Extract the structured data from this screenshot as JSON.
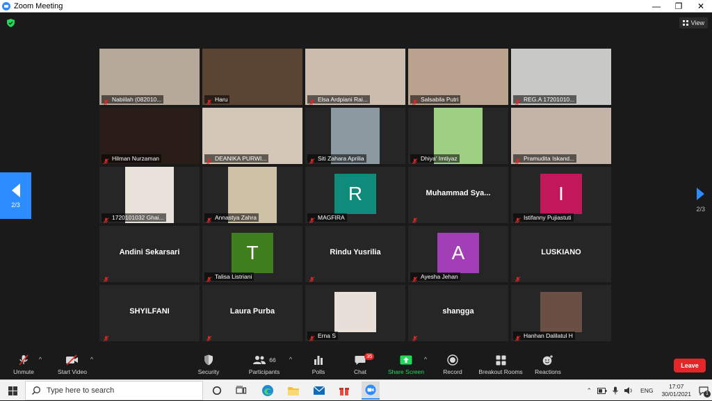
{
  "window": {
    "title": "Zoom Meeting",
    "minimize": "—",
    "maximize": "❐",
    "close": "✕"
  },
  "view_button": {
    "label": "View"
  },
  "pager": {
    "left_label": "2/3",
    "right_label": "2/3"
  },
  "participants": [
    {
      "name": "Nabiilah (082010...",
      "type": "video",
      "bg": "#b7a99a"
    },
    {
      "name": "Haru",
      "type": "video",
      "bg": "#5a4434"
    },
    {
      "name": "Elsa Ardpiani Rai...",
      "type": "video",
      "bg": "#cbbcae"
    },
    {
      "name": "Salsabila Putri",
      "type": "video",
      "bg": "#b9a38e"
    },
    {
      "name": "REG.A 17201010...",
      "type": "video",
      "bg": "#c8c9c4"
    },
    {
      "name": "Hilman Nurzaman",
      "type": "video",
      "bg": "#2a1d18"
    },
    {
      "name": "DEANIKA PURWI...",
      "type": "video",
      "bg": "#d4c7b8"
    },
    {
      "name": "Siti Zahara Aprilia",
      "type": "video-small",
      "bg": "#8a9aa0"
    },
    {
      "name": "Dhiya' Imtiyaz",
      "type": "video-small",
      "bg": "#9fcf83"
    },
    {
      "name": "Pramudita Iskand...",
      "type": "video",
      "bg": "#c3b4a7"
    },
    {
      "name": "1720101032 Ghai...",
      "type": "video-small",
      "bg": "#e8e2da"
    },
    {
      "name": "Annastya Zahra",
      "type": "video-small",
      "bg": "#cfc1a6"
    },
    {
      "name": "MAGFIRA",
      "type": "letter",
      "letter": "R",
      "color": "#0f8b7c"
    },
    {
      "name": "Muhammad  Sya...",
      "type": "bigname"
    },
    {
      "name": "Istifanny Pujiastuti",
      "type": "letter",
      "letter": "I",
      "color": "#c2185b"
    },
    {
      "name": "Andini Sekarsari",
      "type": "bigname"
    },
    {
      "name": "Talisa Listriani",
      "type": "letter",
      "letter": "T",
      "color": "#3f7f1e"
    },
    {
      "name": "Rindu Yusrilia",
      "type": "bigname"
    },
    {
      "name": "Ayesha Jehan",
      "type": "letter",
      "letter": "A",
      "color": "#a23fb6"
    },
    {
      "name": "LUSKIANO",
      "type": "bigname"
    },
    {
      "name": "SHYILFANI",
      "type": "bigname"
    },
    {
      "name": "Laura Purba",
      "type": "bigname"
    },
    {
      "name": "Erna S",
      "type": "picture",
      "color": "#e7dfd8"
    },
    {
      "name": "shangga",
      "type": "bigname"
    },
    {
      "name": "Hanhan Dalilatul H",
      "type": "picture",
      "color": "#6b4f45"
    }
  ],
  "toolbar": {
    "unmute": "Unmute",
    "start_video": "Start Video",
    "security": "Security",
    "participants": "Participants",
    "participants_count": "66",
    "polls": "Polls",
    "chat": "Chat",
    "chat_badge": "35",
    "share_screen": "Share Screen",
    "record": "Record",
    "breakout_rooms": "Breakout Rooms",
    "reactions": "Reactions",
    "leave": "Leave",
    "accent_green": "#23d959",
    "leave_red": "#e02828"
  },
  "taskbar": {
    "search_placeholder": "Type here to search",
    "language": "ENG",
    "time": "17:07",
    "date": "30/01/2021",
    "notification_count": "1"
  }
}
